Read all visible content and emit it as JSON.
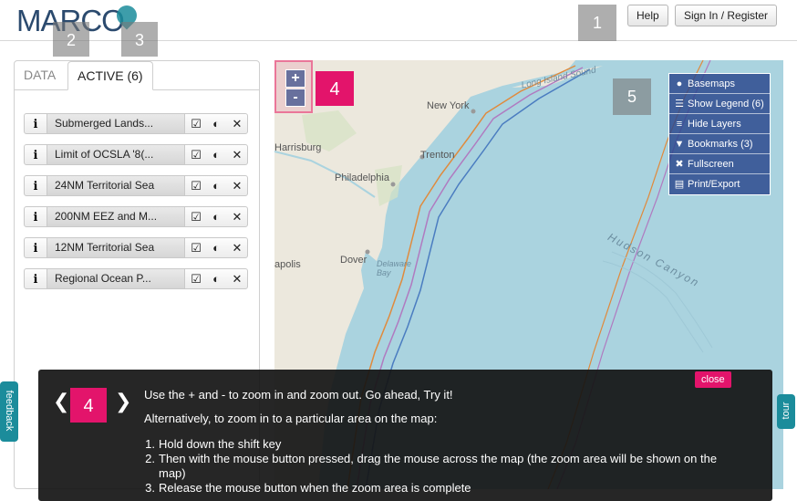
{
  "header": {
    "logo_text": "MARCO",
    "help_label": "Help",
    "signin_label": "Sign In / Register"
  },
  "tour_markers": [
    "1",
    "2",
    "3",
    "4",
    "5"
  ],
  "panel": {
    "tabs": [
      {
        "label": "DATA"
      },
      {
        "label": "ACTIVE (6)"
      }
    ],
    "layers": [
      {
        "name": "Submerged Lands..."
      },
      {
        "name": "Limit of OCSLA '8(..."
      },
      {
        "name": "24NM Territorial Sea"
      },
      {
        "name": "200NM EEZ and M..."
      },
      {
        "name": "12NM Territorial Sea"
      },
      {
        "name": "Regional Ocean P..."
      }
    ]
  },
  "map": {
    "zoom_in": "+",
    "zoom_out": "-",
    "places": [
      "New York",
      "Trenton",
      "Harrisburg",
      "Philadelphia",
      "Dover",
      "apolis"
    ],
    "water_labels": [
      "Long Island Sound",
      "Delaware Bay",
      "Hudson Canyon"
    ],
    "tools": [
      {
        "icon": "globe-icon",
        "label": "Basemaps"
      },
      {
        "icon": "list-icon",
        "label": "Show Legend (6)"
      },
      {
        "icon": "layers-icon",
        "label": "Hide Layers"
      },
      {
        "icon": "map-pin-icon",
        "label": "Bookmarks (3)"
      },
      {
        "icon": "fullscreen-icon",
        "label": "Fullscreen"
      },
      {
        "icon": "print-icon",
        "label": "Print/Export"
      }
    ]
  },
  "tour": {
    "step": "4",
    "prev": "❮",
    "next": "❯",
    "close_label": "close",
    "line1": "Use the + and - to zoom in and zoom out. Go ahead, Try it!",
    "line2": "Alternatively, to zoom in to a particular area on the map:",
    "steps": [
      "Hold down the shift key",
      "Then with the mouse button pressed, drag the mouse across the map (the zoom area will be shown on the map)",
      "Release the mouse button when the zoom area is complete"
    ]
  },
  "side_tabs": {
    "feedback": "feedback",
    "tour": "tour"
  },
  "colors": {
    "accent_pink": "#e3146b",
    "tool_blue": "#28468c",
    "teal": "#1b8c9b"
  }
}
